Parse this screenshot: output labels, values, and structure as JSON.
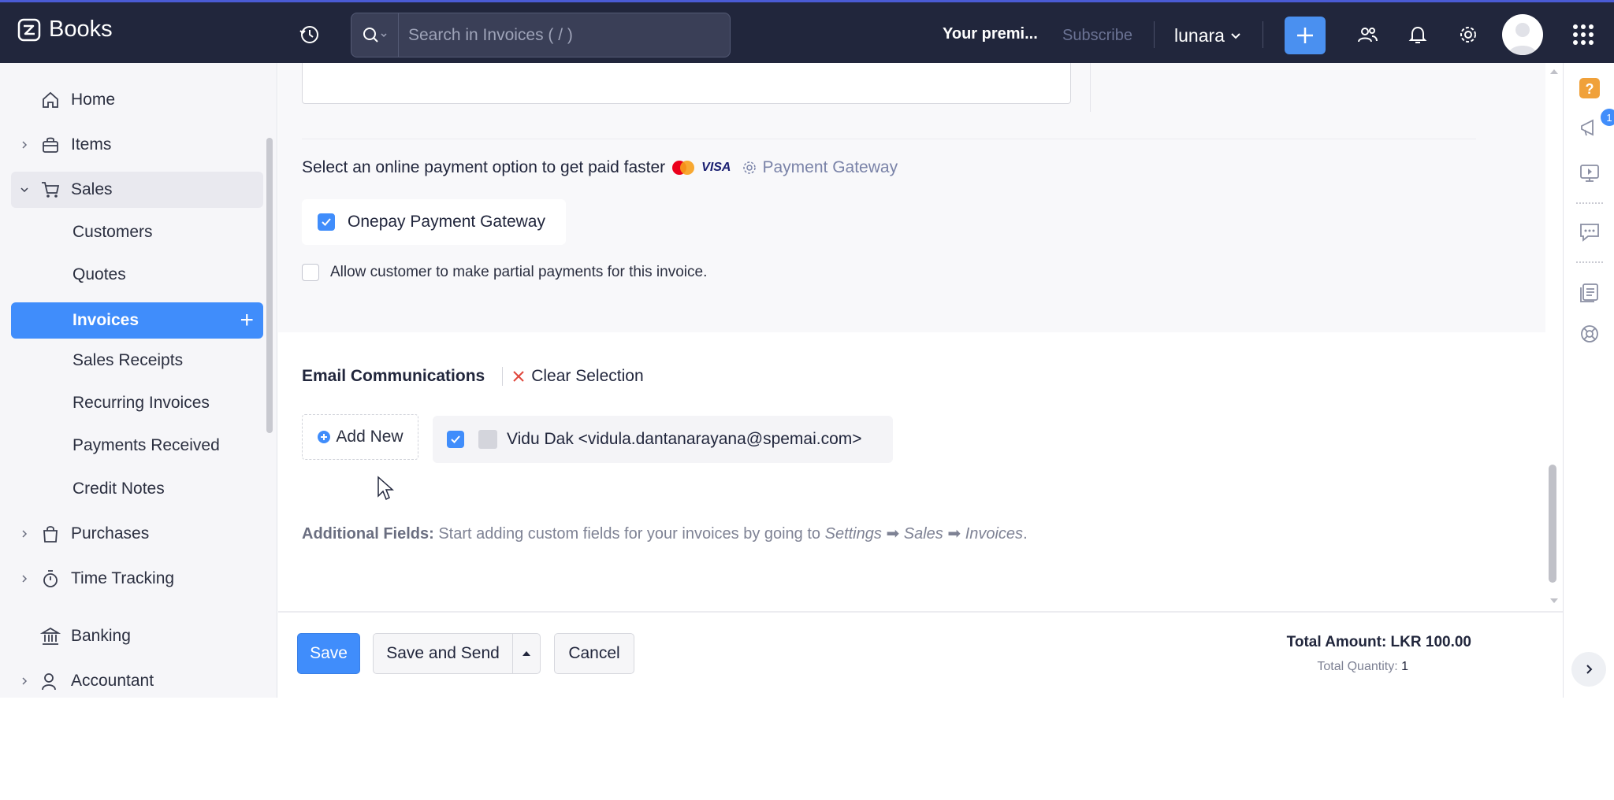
{
  "app": {
    "name": "Books"
  },
  "search": {
    "placeholder": "Search in Invoices ( / )"
  },
  "header": {
    "premium_text": "Your premi...",
    "subscribe_label": "Subscribe",
    "org_name": "lunara"
  },
  "sidebar": {
    "items": [
      {
        "label": "Home"
      },
      {
        "label": "Items"
      },
      {
        "label": "Sales"
      },
      {
        "label": "Purchases"
      },
      {
        "label": "Time Tracking"
      },
      {
        "label": "Banking"
      },
      {
        "label": "Accountant"
      }
    ],
    "sales_sub": [
      {
        "label": "Customers"
      },
      {
        "label": "Quotes"
      },
      {
        "label": "Invoices"
      },
      {
        "label": "Sales Receipts"
      },
      {
        "label": "Recurring Invoices"
      },
      {
        "label": "Payments Received"
      },
      {
        "label": "Credit Notes"
      }
    ]
  },
  "payment": {
    "title": "Select an online payment option to get paid faster",
    "visa_text": "VISA",
    "gateway_link": "Payment Gateway",
    "gateway_option": "Onepay Payment Gateway",
    "gateway_checked": true,
    "partial_label": "Allow customer to make partial payments for this invoice.",
    "partial_checked": false
  },
  "email": {
    "title": "Email Communications",
    "clear_label": "Clear Selection",
    "add_new_label": "Add New",
    "contact": "Vidu Dak <vidula.dantanarayana@spemai.com>",
    "contact_checked": true
  },
  "additional": {
    "label": "Additional Fields:",
    "text": "Start adding custom fields for your invoices by going to",
    "path1": "Settings",
    "path2": "Sales",
    "path3": "Invoices",
    "end": "."
  },
  "footer": {
    "save_label": "Save",
    "save_send_label": "Save and Send",
    "cancel_label": "Cancel",
    "total_amount": "Total Amount: LKR 100.00",
    "total_qty_label": "Total Quantity:",
    "total_qty_value": "1"
  },
  "rightbar": {
    "notification_count": "1"
  },
  "colors": {
    "header_bg": "#21263c",
    "accent": "#408dfb",
    "premium_badge": "#f0a13a"
  }
}
